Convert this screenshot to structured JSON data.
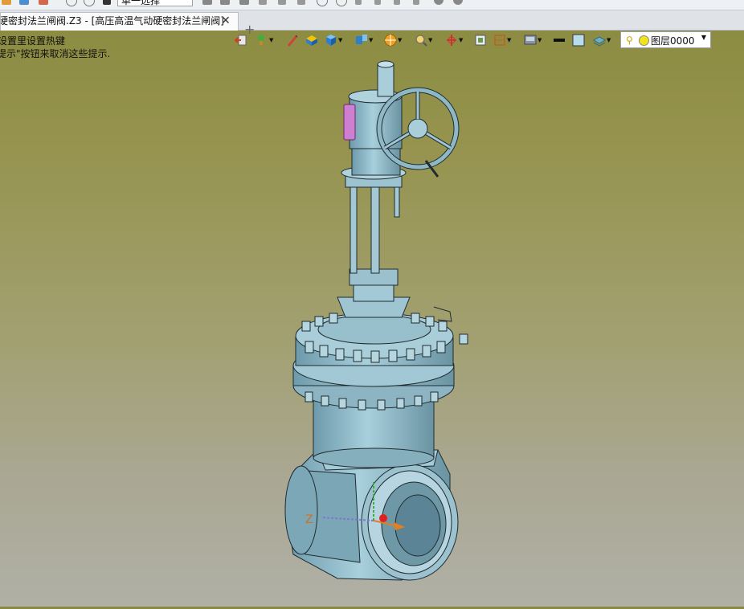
{
  "window": {
    "select_mode": "单一选择"
  },
  "tab": {
    "title": "硬密封法兰闸阀.Z3 - [高压高温气动硬密封法兰闸阀]",
    "close": "✕",
    "new_tab": "+"
  },
  "hints": {
    "line1": "设置里设置热键",
    "line2": "提示\"按钮来取消这些提示."
  },
  "layer": {
    "name": "图层0000"
  },
  "axes": {
    "z_label": "Z"
  },
  "colors": {
    "model_fill": "#8fb8c6",
    "model_stroke": "#1e2b30",
    "handle": "#cf7fd0",
    "background_top": "#8a8a3f",
    "background_bottom": "#b0b0a6"
  }
}
